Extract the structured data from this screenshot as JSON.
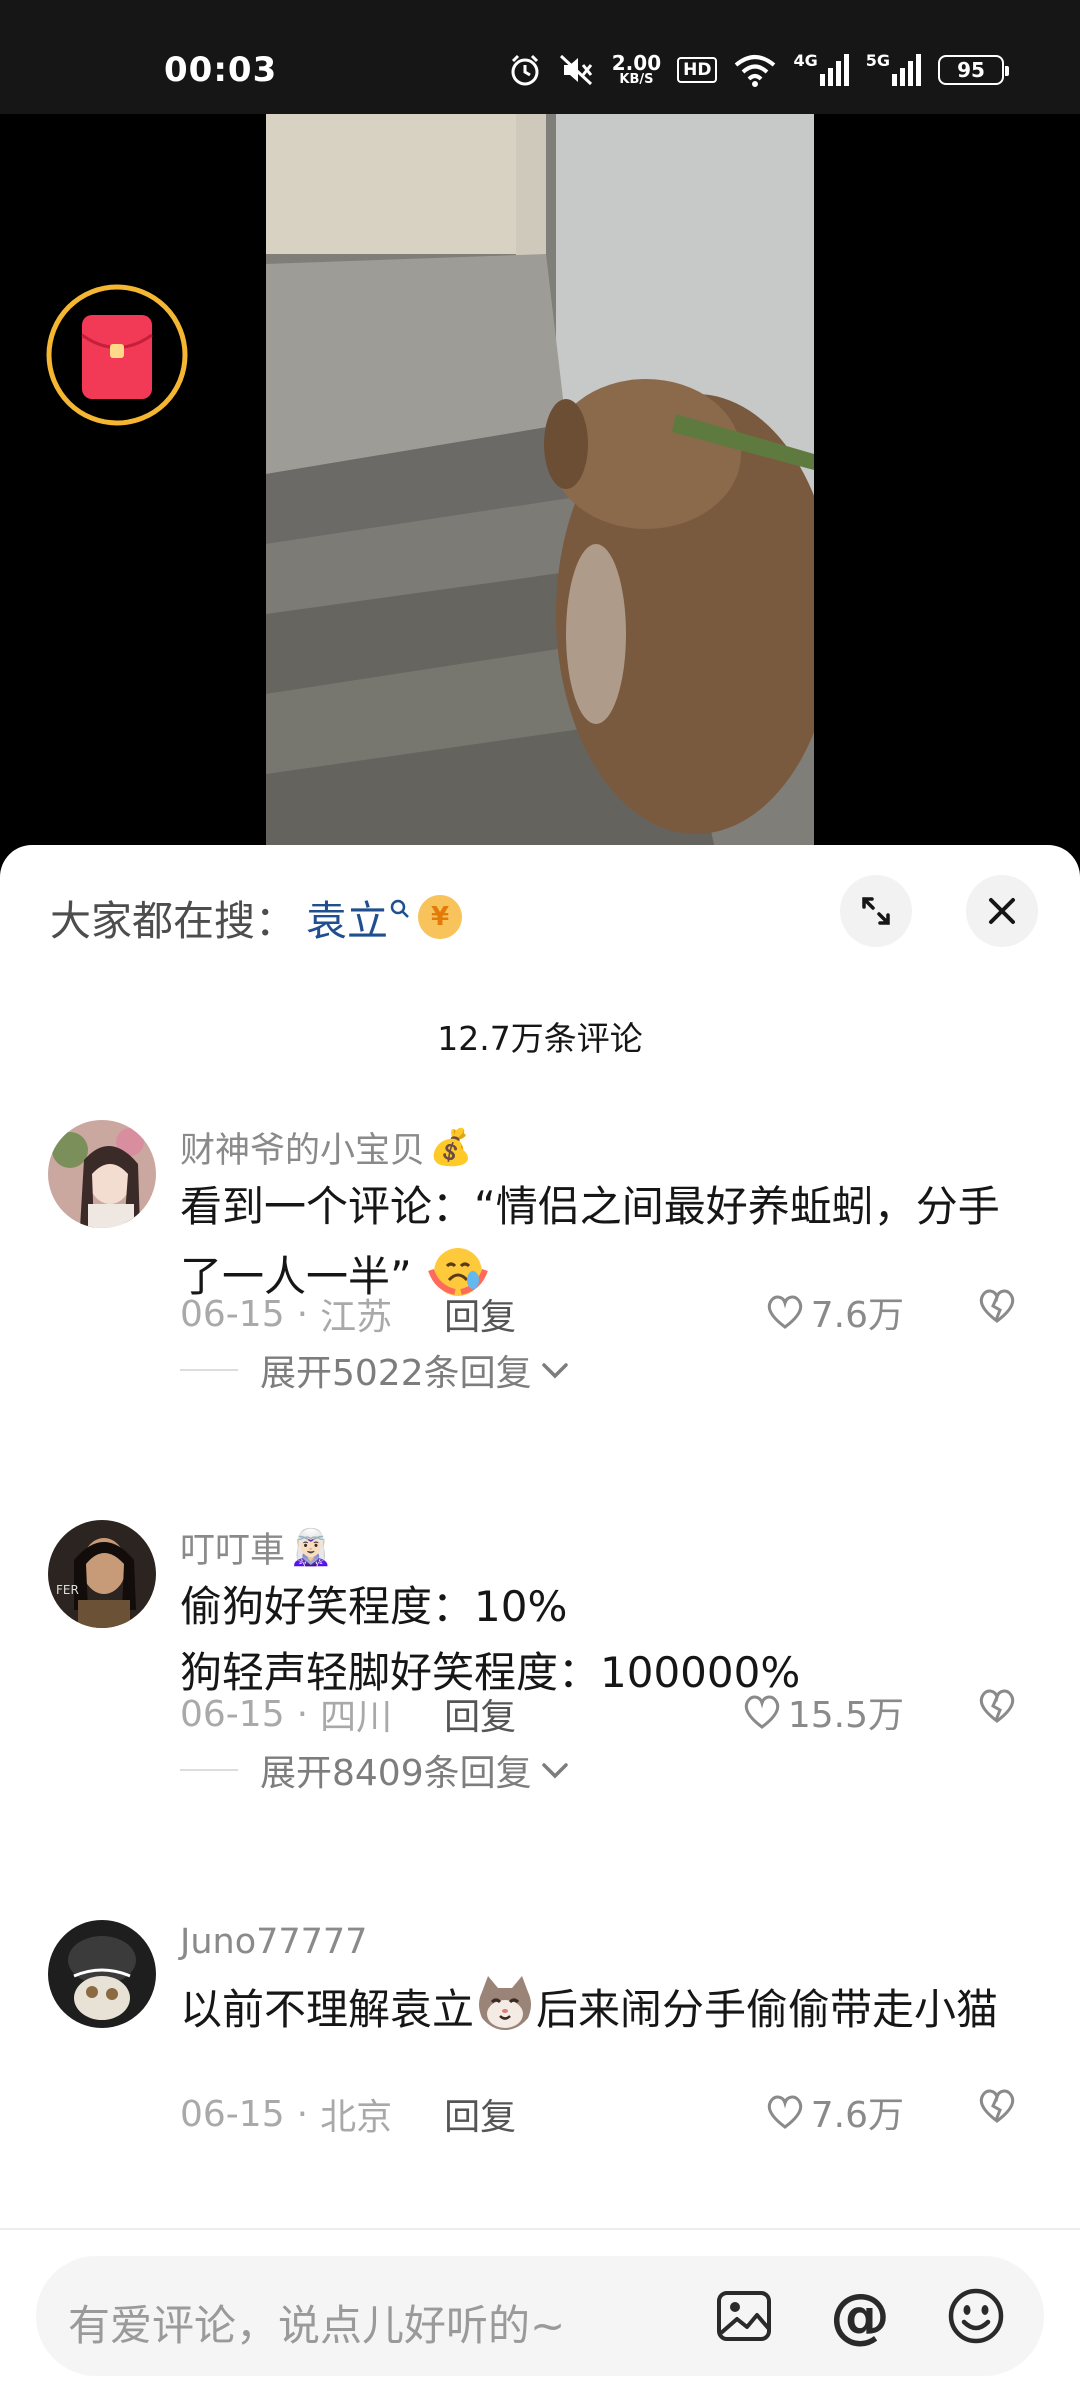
{
  "status_bar": {
    "time": "00:03",
    "net_speed_value": "2.00",
    "net_speed_unit": "KB/S",
    "hd_label": "HD",
    "network_1": "4G",
    "network_2": "5G",
    "battery_level": "95",
    "icons": [
      "alarm-icon",
      "mute-icon",
      "wifi-icon",
      "signal-icon"
    ]
  },
  "video": {
    "envelope_icon": "red-envelope-icon"
  },
  "sheet": {
    "search_prefix": "大家都在搜：",
    "search_term": "袁立",
    "comment_count": "12.7万条评论",
    "expand_icon": "expand-icon",
    "close_icon": "close-icon"
  },
  "comments": [
    {
      "username": "财神爷的小宝贝",
      "username_emoji": "💰",
      "text": "看到一个评论：“情侣之间最好养蚯蚓，分手了一人一半”",
      "date": "06-15",
      "location": "江苏",
      "reply_label": "回复",
      "likes": "7.6万",
      "expand_label": "展开5022条回复"
    },
    {
      "username": "叮叮車",
      "username_emoji": "🧝🏻‍♀️",
      "text_line1": "偷狗好笑程度：10%",
      "text_line2": "狗轻声轻脚好笑程度：100000%",
      "date": "06-15",
      "location": "四川",
      "reply_label": "回复",
      "likes": "15.5万",
      "expand_label": "展开8409条回复"
    },
    {
      "username": "Juno77777",
      "text_part1": "以前不理解袁立",
      "text_part2": "后来闹分手偷偷带走小猫",
      "date": "06-15",
      "location": "北京",
      "reply_label": "回复",
      "likes": "7.6万"
    }
  ],
  "input_bar": {
    "placeholder": "有爱评论，说点儿好听的~",
    "icons": [
      "image-icon",
      "at-icon",
      "emoji-icon"
    ],
    "at_symbol": "@"
  },
  "colors": {
    "accent_link": "#1f4f8f",
    "envelope_red": "#f23a57",
    "ring_gold": "#f5b731"
  }
}
